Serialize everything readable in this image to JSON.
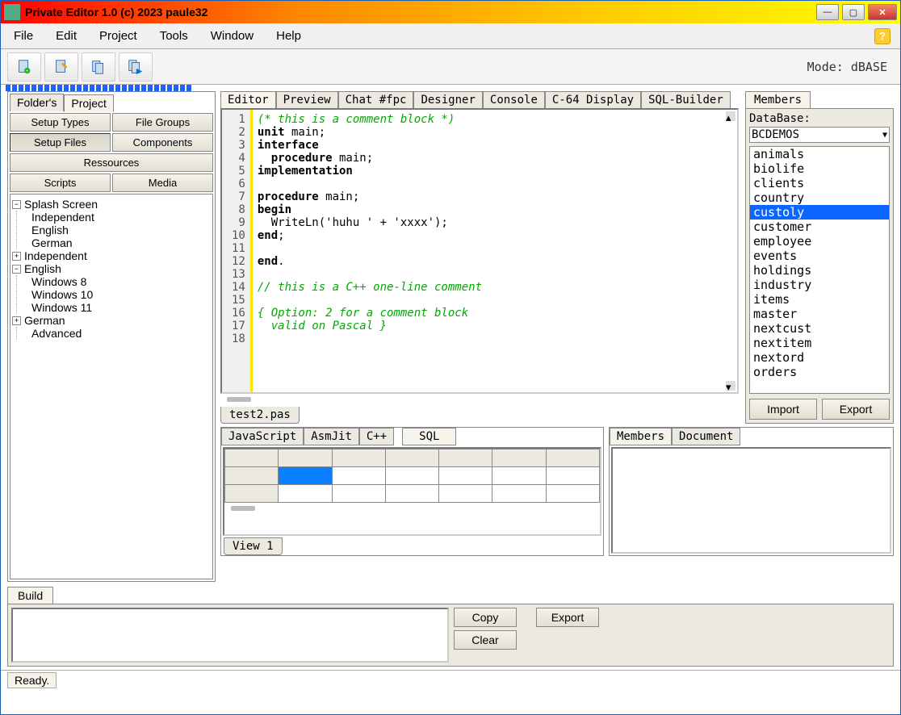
{
  "window": {
    "title": "Private Editor 1.0 (c) 2023 paule32"
  },
  "menu": [
    "File",
    "Edit",
    "Project",
    "Tools",
    "Window",
    "Help"
  ],
  "mode_label": "Mode: dBASE",
  "left_tabs": [
    "Folder's",
    "Project"
  ],
  "left_buttons_row1": [
    "Setup Types",
    "File Groups"
  ],
  "left_buttons_row2": [
    "Setup Files",
    "Components"
  ],
  "left_button_ressources": "Ressources",
  "left_buttons_row3": [
    "Scripts",
    "Media"
  ],
  "tree": {
    "n0": "Splash Screen",
    "n0_0": "Independent",
    "n0_1": "English",
    "n0_2": "German",
    "n1": "Independent",
    "n2": "English",
    "n2_0": "Windows  8",
    "n2_1": "Windows 10",
    "n2_2": "Windows 11",
    "n3": "German",
    "n4": "Advanced"
  },
  "editor_tabs": [
    "Editor",
    "Preview",
    "Chat #fpc",
    "Designer",
    "Console",
    "C-64 Display",
    "SQL-Builder"
  ],
  "code_lines": {
    "l1": "(* this is a comment block *)",
    "l2a": "unit",
    "l2b": " main;",
    "l3": "interface",
    "l4a": "  procedure",
    "l4b": " main;",
    "l5": "implementation",
    "l7a": "procedure",
    "l7b": " main;",
    "l8": "begin",
    "l9": "  WriteLn('huhu ' + 'xxxx');",
    "l10": "end",
    "l12": "end",
    "l14": "// this is a C++ one-line comment",
    "l16": "{ Option: 2 for a comment block",
    "l17": "  valid on Pascal }"
  },
  "line_numbers": [
    "1",
    "2",
    "3",
    "4",
    "5",
    "6",
    "7",
    "8",
    "9",
    "10",
    "11",
    "12",
    "13",
    "14",
    "15",
    "16",
    "17",
    "18"
  ],
  "file_tab": "test2.pas",
  "lang_tabs": [
    "JavaScript",
    "AsmJit",
    "C++"
  ],
  "sql_tab": "SQL",
  "view_tab": "View 1",
  "bottom_right_tabs": [
    "Members",
    "Document"
  ],
  "right_tab": "Members",
  "db_label": "DataBase:",
  "db_combo": "BCDEMOS",
  "tables": [
    "animals",
    "biolife",
    "clients",
    "country",
    "custoly",
    "customer",
    "employee",
    "events",
    "holdings",
    "industry",
    "items",
    "master",
    "nextcust",
    "nextitem",
    "nextord",
    "orders"
  ],
  "table_selected_index": 4,
  "import_btn": "Import",
  "export_btn": "Export",
  "build_tab": "Build",
  "copy_btn": "Copy",
  "export2_btn": "Export",
  "clear_btn": "Clear",
  "status": "Ready."
}
